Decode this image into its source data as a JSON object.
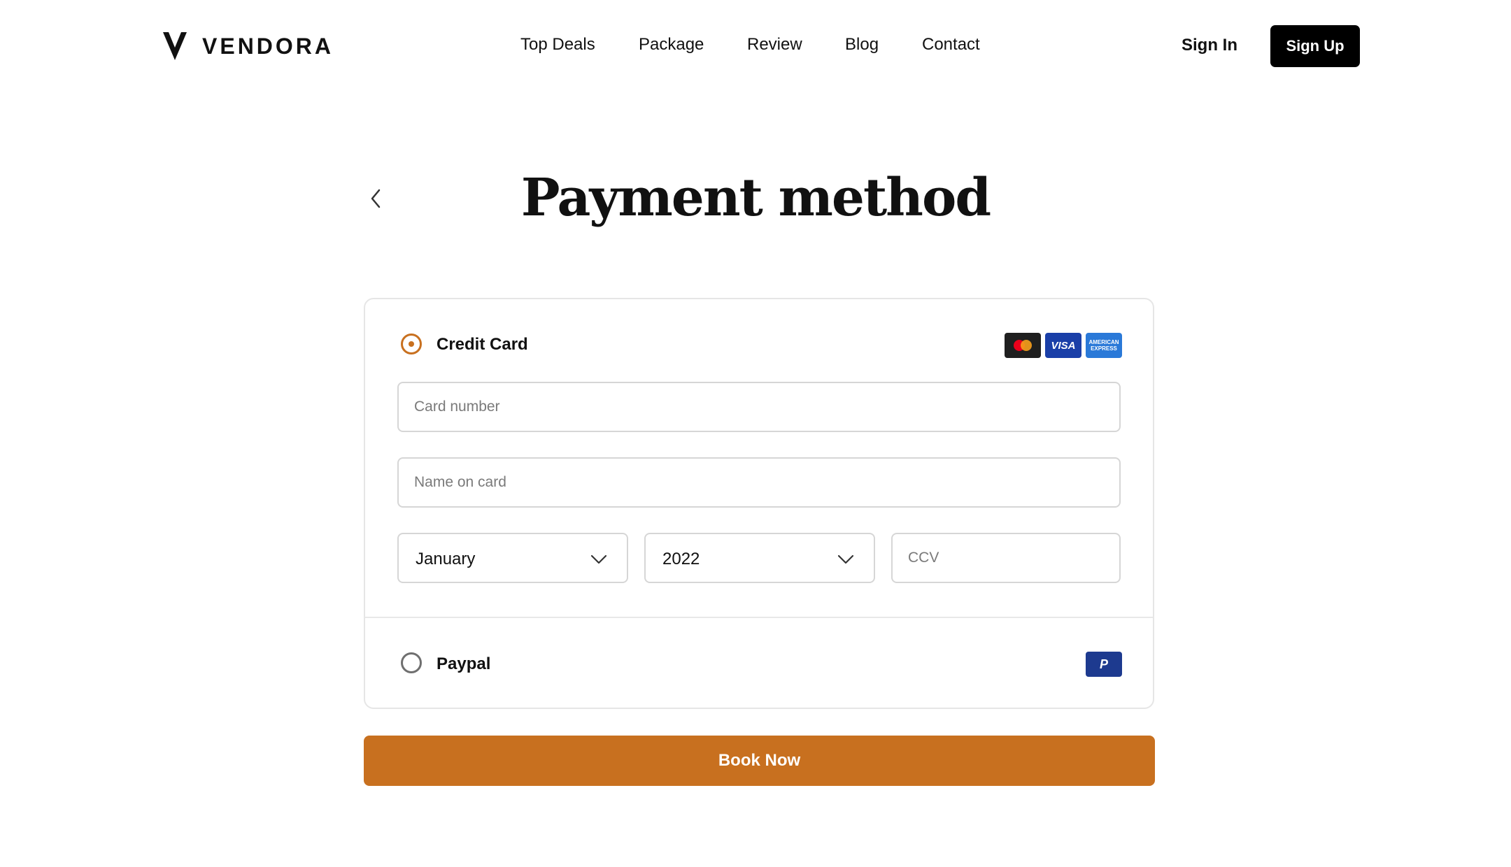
{
  "brand": {
    "name": "VENDORA",
    "logo_icon": "vendora-logo-icon"
  },
  "nav": {
    "items": [
      {
        "label": "Top Deals"
      },
      {
        "label": "Package"
      },
      {
        "label": "Review"
      },
      {
        "label": "Blog"
      },
      {
        "label": "Contact"
      }
    ],
    "sign_in": "Sign In",
    "sign_up": "Sign Up"
  },
  "page": {
    "title": "Payment method",
    "back_icon": "chevron-left-icon"
  },
  "payment": {
    "credit_card": {
      "label": "Credit Card",
      "selected": true,
      "brands": {
        "visa": "VISA",
        "amex": "AMERICAN EXPRESS",
        "mastercard_icon": "mastercard-icon"
      },
      "card_number": {
        "placeholder": "Card number",
        "value": ""
      },
      "name_on_card": {
        "placeholder": "Name on card",
        "value": ""
      },
      "month": {
        "value": "January"
      },
      "year": {
        "value": "2022"
      },
      "ccv": {
        "placeholder": "CCV",
        "value": ""
      }
    },
    "paypal": {
      "label": "Paypal",
      "selected": false,
      "logo_text": "P"
    }
  },
  "actions": {
    "book_now": "Book Now"
  },
  "colors": {
    "accent": "#c8701f",
    "primary_button": "#000000",
    "border": "#d6d6d6"
  }
}
